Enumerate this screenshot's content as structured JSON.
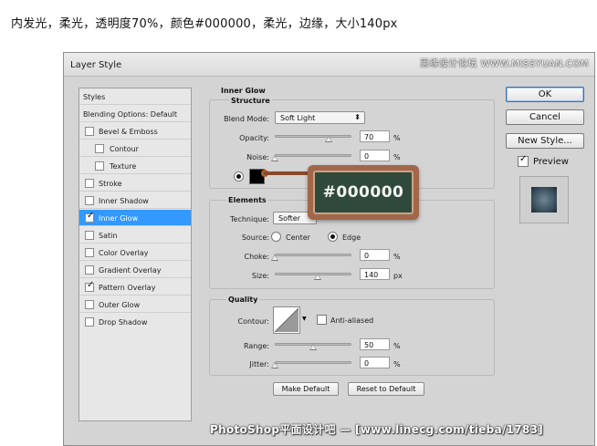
{
  "caption": "内发光，柔光，透明度70%，颜色#000000，柔光，边缘，大小140px",
  "dialog": {
    "title": "Layer Style",
    "watermark_top": "思缘设计论坛 WWW.MISSYUAN.COM"
  },
  "styles_list": {
    "header": "Styles",
    "blending": "Blending Options: Default",
    "items": [
      {
        "label": "Bevel & Emboss",
        "checked": false
      },
      {
        "label": "Contour",
        "checked": false
      },
      {
        "label": "Texture",
        "checked": false
      },
      {
        "label": "Stroke",
        "checked": false
      },
      {
        "label": "Inner Shadow",
        "checked": false
      },
      {
        "label": "Inner Glow",
        "checked": true
      },
      {
        "label": "Satin",
        "checked": false
      },
      {
        "label": "Color Overlay",
        "checked": false
      },
      {
        "label": "Gradient Overlay",
        "checked": false
      },
      {
        "label": "Pattern Overlay",
        "checked": true
      },
      {
        "label": "Outer Glow",
        "checked": false
      },
      {
        "label": "Drop Shadow",
        "checked": false
      }
    ]
  },
  "inner_glow": {
    "title": "Inner Glow",
    "structure": {
      "title": "Structure",
      "blend_mode_label": "Blend Mode:",
      "blend_mode": "Soft Light",
      "opacity_label": "Opacity:",
      "opacity": "70",
      "opacity_unit": "%",
      "opacity_level": 0.7,
      "noise_label": "Noise:",
      "noise": "0",
      "noise_unit": "%",
      "noise_level": 0.0
    },
    "color_callout": "#000000",
    "elements": {
      "title": "Elements",
      "technique_label": "Technique:",
      "technique": "Softer",
      "source_label": "Source:",
      "source_center": "Center",
      "source_edge": "Edge",
      "choke_label": "Choke:",
      "choke": "0",
      "choke_unit": "%",
      "choke_level": 0.0,
      "size_label": "Size:",
      "size": "140",
      "size_unit": "px",
      "size_level": 0.56
    },
    "quality": {
      "title": "Quality",
      "contour_label": "Contour:",
      "anti_aliased": "Anti-aliased",
      "range_label": "Range:",
      "range": "50",
      "range_unit": "%",
      "range_level": 0.5,
      "jitter_label": "Jitter:",
      "jitter": "0",
      "jitter_unit": "%",
      "jitter_level": 0.0
    },
    "make_default": "Make Default",
    "reset_default": "Reset to Default"
  },
  "buttons": {
    "ok": "OK",
    "cancel": "Cancel",
    "new_style": "New Style...",
    "preview": "Preview"
  },
  "watermark_bottom": "PhotoShop平面设计吧 — [www.linecg.com/tieba/1783]"
}
